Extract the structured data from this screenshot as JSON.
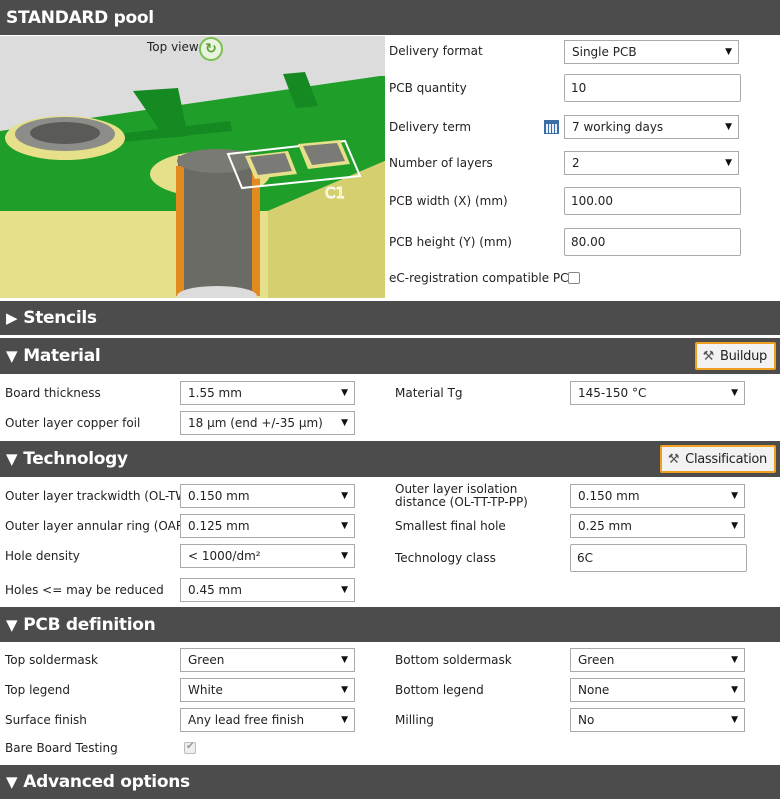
{
  "pool": {
    "title": "STANDARD pool",
    "preview_label": "Top view",
    "silkscreen_text": "C1",
    "fields": {
      "delivery_format_label": "Delivery format",
      "delivery_format_value": "Single PCB",
      "pcb_quantity_label": "PCB quantity",
      "pcb_quantity_value": "10",
      "delivery_term_label": "Delivery term",
      "delivery_term_value": "7 working days",
      "layers_label": "Number of layers",
      "layers_value": "2",
      "width_label": "PCB width (X) (mm)",
      "width_value": "100.00",
      "height_label": "PCB height (Y) (mm)",
      "height_value": "80.00",
      "ec_label": "eC-registration compatible PCB"
    }
  },
  "stencils": {
    "title": "Stencils",
    "arrow": "▶"
  },
  "material": {
    "title": "Material",
    "arrow": "▼",
    "button": "Buildup",
    "board_thickness_label": "Board thickness",
    "board_thickness_value": "1.55 mm",
    "material_tg_label": "Material Tg",
    "material_tg_value": "145-150 °C",
    "copper_label": "Outer layer copper foil",
    "copper_value": "18 µm (end +/-35 µm)"
  },
  "technology": {
    "title": "Technology",
    "arrow": "▼",
    "button": "Classification",
    "trackwidth_label": "Outer layer trackwidth (OL-TW)",
    "trackwidth_value": "0.150 mm",
    "isolation_label": "Outer layer isolation distance (OL-TT-TP-PP)",
    "isolation_value": "0.150 mm",
    "annular_label": "Outer layer annular ring (OAR)",
    "annular_value": "0.125 mm",
    "smallest_hole_label": "Smallest final hole",
    "smallest_hole_value": "0.25 mm",
    "hole_density_label": "Hole density",
    "hole_density_value": "< 1000/dm²",
    "tech_class_label": "Technology class",
    "tech_class_value": "6C",
    "holes_reduced_label": "Holes <= may be reduced",
    "holes_reduced_value": "0.45 mm"
  },
  "pcb_definition": {
    "title": "PCB definition",
    "arrow": "▼",
    "top_soldermask_label": "Top soldermask",
    "top_soldermask_value": "Green",
    "bottom_soldermask_label": "Bottom soldermask",
    "bottom_soldermask_value": "Green",
    "top_legend_label": "Top legend",
    "top_legend_value": "White",
    "bottom_legend_label": "Bottom legend",
    "bottom_legend_value": "None",
    "surface_label": "Surface finish",
    "surface_value": "Any lead free finish",
    "milling_label": "Milling",
    "milling_value": "No",
    "bare_board_label": "Bare Board Testing"
  },
  "advanced": {
    "title": "Advanced options",
    "arrow": "▼"
  },
  "colors": {
    "header_bg": "#4c4c4c",
    "highlight": "#f0a020",
    "pcb_green": "#1f9e2a"
  }
}
